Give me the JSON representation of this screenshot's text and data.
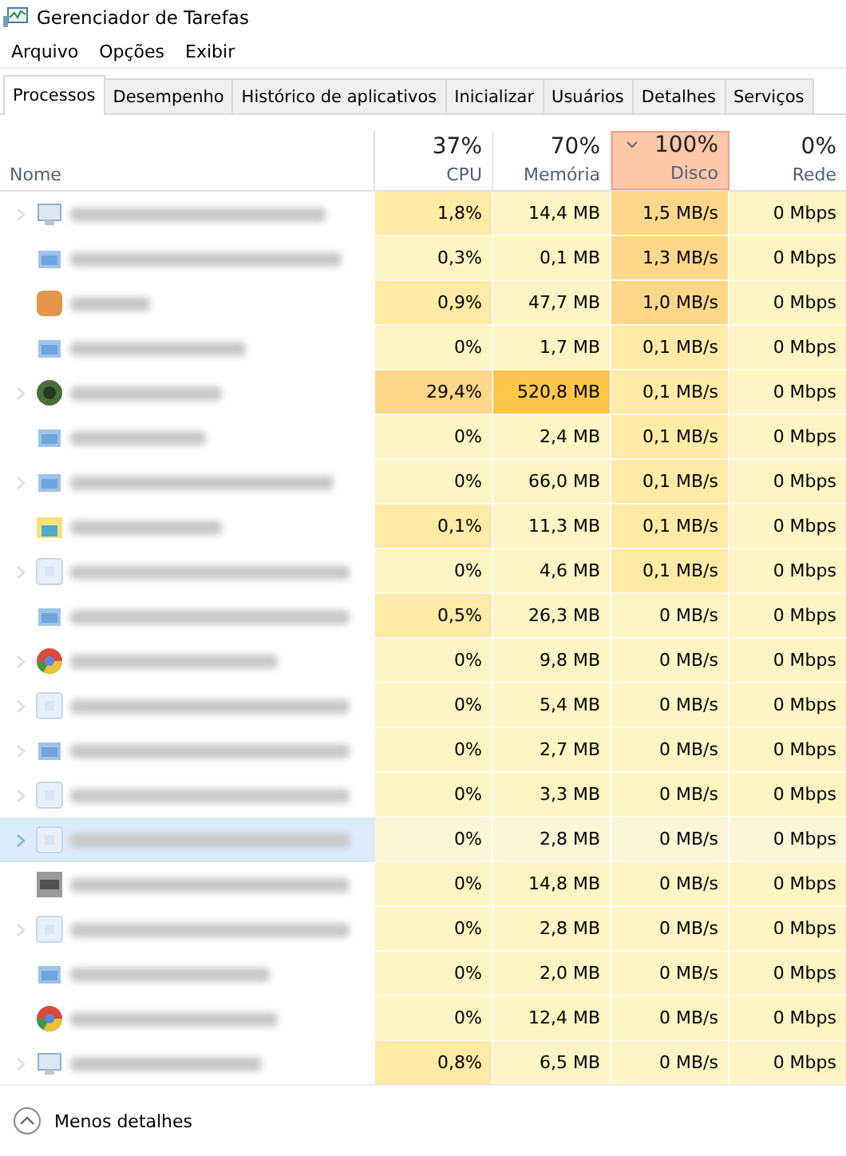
{
  "window": {
    "title": "Gerenciador de Tarefas"
  },
  "menu": [
    "Arquivo",
    "Opções",
    "Exibir"
  ],
  "tabs": [
    {
      "label": "Processos",
      "selected": true
    },
    {
      "label": "Desempenho",
      "selected": false
    },
    {
      "label": "Histórico de aplicativos",
      "selected": false
    },
    {
      "label": "Inicializar",
      "selected": false
    },
    {
      "label": "Usuários",
      "selected": false
    },
    {
      "label": "Detalhes",
      "selected": false
    },
    {
      "label": "Serviços",
      "selected": false
    }
  ],
  "columns": [
    {
      "label": "Nome",
      "sorted": false
    },
    {
      "label": "CPU",
      "total": "37%",
      "sorted": false
    },
    {
      "label": "Memória",
      "total": "70%",
      "sorted": false
    },
    {
      "label": "Disco",
      "total": "100%",
      "sorted": true
    },
    {
      "label": "Rede",
      "total": "0%",
      "sorted": false
    }
  ],
  "rows": [
    {
      "kind": "monitor",
      "expandable": true,
      "selected": false,
      "cells": [
        {
          "text": "1,8%",
          "color": "#ffeaa6"
        },
        {
          "text": "14,4 MB",
          "color": "#fff4c4"
        },
        {
          "text": "1,5 MB/s",
          "color": "#ffd68a"
        },
        {
          "text": "0 Mbps",
          "color": "#fff4c4"
        }
      ]
    },
    {
      "kind": "window",
      "expandable": false,
      "selected": false,
      "cells": [
        {
          "text": "0,3%",
          "color": "#fff4c4"
        },
        {
          "text": "0,1 MB",
          "color": "#fff4c4"
        },
        {
          "text": "1,3 MB/s",
          "color": "#ffd68a"
        },
        {
          "text": "0 Mbps",
          "color": "#fff4c4"
        }
      ]
    },
    {
      "kind": "square",
      "expandable": false,
      "selected": false,
      "cells": [
        {
          "text": "0,9%",
          "color": "#ffeaa6"
        },
        {
          "text": "47,7 MB",
          "color": "#fff4c4"
        },
        {
          "text": "1,0 MB/s",
          "color": "#ffd68a"
        },
        {
          "text": "0 Mbps",
          "color": "#fff4c4"
        }
      ]
    },
    {
      "kind": "window",
      "expandable": false,
      "selected": false,
      "cells": [
        {
          "text": "0%",
          "color": "#fff4c4"
        },
        {
          "text": "1,7 MB",
          "color": "#fff4c4"
        },
        {
          "text": "0,1 MB/s",
          "color": "#ffeaa6"
        },
        {
          "text": "0 Mbps",
          "color": "#fff4c4"
        }
      ]
    },
    {
      "kind": "disc",
      "expandable": true,
      "selected": false,
      "cells": [
        {
          "text": "29,4%",
          "color": "#ffd68a"
        },
        {
          "text": "520,8 MB",
          "color": "#ffc64a"
        },
        {
          "text": "0,1 MB/s",
          "color": "#ffeaa6"
        },
        {
          "text": "0 Mbps",
          "color": "#fff4c4"
        }
      ]
    },
    {
      "kind": "window",
      "expandable": false,
      "selected": false,
      "cells": [
        {
          "text": "0%",
          "color": "#fff4c4"
        },
        {
          "text": "2,4 MB",
          "color": "#fff4c4"
        },
        {
          "text": "0,1 MB/s",
          "color": "#ffeaa6"
        },
        {
          "text": "0 Mbps",
          "color": "#fff4c4"
        }
      ]
    },
    {
      "kind": "window",
      "expandable": true,
      "selected": false,
      "cells": [
        {
          "text": "0%",
          "color": "#fff4c4"
        },
        {
          "text": "66,0 MB",
          "color": "#fff4c4"
        },
        {
          "text": "0,1 MB/s",
          "color": "#ffeaa6"
        },
        {
          "text": "0 Mbps",
          "color": "#fff4c4"
        }
      ]
    },
    {
      "kind": "folder",
      "expandable": false,
      "selected": false,
      "cells": [
        {
          "text": "0,1%",
          "color": "#ffeaa6"
        },
        {
          "text": "11,3 MB",
          "color": "#fff4c4"
        },
        {
          "text": "0,1 MB/s",
          "color": "#ffeaa6"
        },
        {
          "text": "0 Mbps",
          "color": "#fff4c4"
        }
      ]
    },
    {
      "kind": "frame",
      "expandable": true,
      "selected": false,
      "cells": [
        {
          "text": "0%",
          "color": "#fff4c4"
        },
        {
          "text": "4,6 MB",
          "color": "#fff4c4"
        },
        {
          "text": "0,1 MB/s",
          "color": "#ffeaa6"
        },
        {
          "text": "0 Mbps",
          "color": "#fff4c4"
        }
      ]
    },
    {
      "kind": "window",
      "expandable": false,
      "selected": false,
      "cells": [
        {
          "text": "0,5%",
          "color": "#ffeaa6"
        },
        {
          "text": "26,3 MB",
          "color": "#fff4c4"
        },
        {
          "text": "0 MB/s",
          "color": "#fff4c4"
        },
        {
          "text": "0 Mbps",
          "color": "#fff4c4"
        }
      ]
    },
    {
      "kind": "wheel",
      "expandable": true,
      "selected": false,
      "cells": [
        {
          "text": "0%",
          "color": "#fff4c4"
        },
        {
          "text": "9,8 MB",
          "color": "#fff4c4"
        },
        {
          "text": "0 MB/s",
          "color": "#fff4c4"
        },
        {
          "text": "0 Mbps",
          "color": "#fff4c4"
        }
      ]
    },
    {
      "kind": "frame",
      "expandable": true,
      "selected": false,
      "cells": [
        {
          "text": "0%",
          "color": "#fff4c4"
        },
        {
          "text": "5,4 MB",
          "color": "#fff4c4"
        },
        {
          "text": "0 MB/s",
          "color": "#fff4c4"
        },
        {
          "text": "0 Mbps",
          "color": "#fff4c4"
        }
      ]
    },
    {
      "kind": "window",
      "expandable": true,
      "selected": false,
      "cells": [
        {
          "text": "0%",
          "color": "#fff4c4"
        },
        {
          "text": "2,7 MB",
          "color": "#fff4c4"
        },
        {
          "text": "0 MB/s",
          "color": "#fff4c4"
        },
        {
          "text": "0 Mbps",
          "color": "#fff4c4"
        }
      ]
    },
    {
      "kind": "frame",
      "expandable": true,
      "selected": false,
      "cells": [
        {
          "text": "0%",
          "color": "#fff4c4"
        },
        {
          "text": "3,3 MB",
          "color": "#fff4c4"
        },
        {
          "text": "0 MB/s",
          "color": "#fff4c4"
        },
        {
          "text": "0 Mbps",
          "color": "#fff4c4"
        }
      ]
    },
    {
      "kind": "frame",
      "expandable": true,
      "selected": true,
      "cells": [
        {
          "text": "0%",
          "color": "#fcf5d6"
        },
        {
          "text": "2,8 MB",
          "color": "#fcf5d6"
        },
        {
          "text": "0 MB/s",
          "color": "#fcf5d6"
        },
        {
          "text": "0 Mbps",
          "color": "#fcf5d6"
        }
      ]
    },
    {
      "kind": "terminal",
      "expandable": false,
      "selected": false,
      "cells": [
        {
          "text": "0%",
          "color": "#fff4c4"
        },
        {
          "text": "14,8 MB",
          "color": "#fff4c4"
        },
        {
          "text": "0 MB/s",
          "color": "#fff4c4"
        },
        {
          "text": "0 Mbps",
          "color": "#fff4c4"
        }
      ]
    },
    {
      "kind": "frame",
      "expandable": true,
      "selected": false,
      "cells": [
        {
          "text": "0%",
          "color": "#fff4c4"
        },
        {
          "text": "2,8 MB",
          "color": "#fff4c4"
        },
        {
          "text": "0 MB/s",
          "color": "#fff4c4"
        },
        {
          "text": "0 Mbps",
          "color": "#fff4c4"
        }
      ]
    },
    {
      "kind": "window",
      "expandable": false,
      "selected": false,
      "cells": [
        {
          "text": "0%",
          "color": "#fff4c4"
        },
        {
          "text": "2,0 MB",
          "color": "#fff4c4"
        },
        {
          "text": "0 MB/s",
          "color": "#fff4c4"
        },
        {
          "text": "0 Mbps",
          "color": "#fff4c4"
        }
      ]
    },
    {
      "kind": "wheel",
      "expandable": false,
      "selected": false,
      "cells": [
        {
          "text": "0%",
          "color": "#fff4c4"
        },
        {
          "text": "12,4 MB",
          "color": "#fff4c4"
        },
        {
          "text": "0 MB/s",
          "color": "#fff4c4"
        },
        {
          "text": "0 Mbps",
          "color": "#fff4c4"
        }
      ]
    },
    {
      "kind": "monitor",
      "expandable": true,
      "selected": false,
      "cells": [
        {
          "text": "0,8%",
          "color": "#ffeaa6"
        },
        {
          "text": "6,5 MB",
          "color": "#fff4c4"
        },
        {
          "text": "0 MB/s",
          "color": "#fff4c4"
        },
        {
          "text": "0 Mbps",
          "color": "#fff4c4"
        }
      ]
    }
  ],
  "footer": {
    "label": "Menos detalhes"
  }
}
